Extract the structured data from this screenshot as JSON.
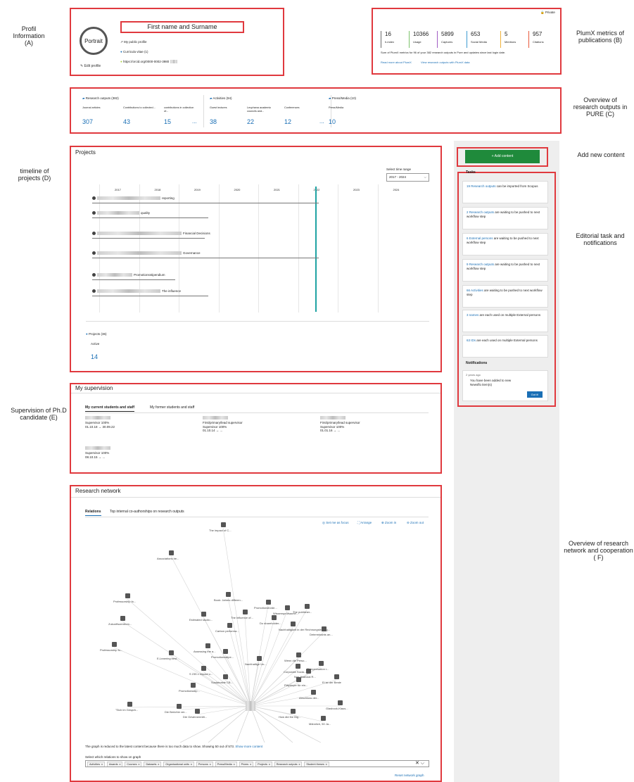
{
  "annotations": {
    "a": "Profil Information (A)",
    "b": "PlumX metrics of publications (B)",
    "c": "Overview of research outputs in PURE (C)",
    "add": "Add new content",
    "d": "timeline of projects (D)",
    "tasks": "Editorial task and notifications",
    "e": "Supervision of Ph.D candidate (E)",
    "f": "Overview of research network and cooperation ( F)"
  },
  "profile": {
    "portrait": "Portrait",
    "name": "First name and Surname",
    "links": [
      "My public profile",
      "Curricula vitae (1)",
      "https://orcid.org/0000-0002-3980"
    ],
    "edit": "Edit profile"
  },
  "plumx": {
    "private": "Private",
    "metrics": [
      {
        "value": "16",
        "label": "h-index"
      },
      {
        "value": "10366",
        "label": "Usage"
      },
      {
        "value": "5899",
        "label": "Captures"
      },
      {
        "value": "653",
        "label": "Social Media"
      },
      {
        "value": "5",
        "label": "Mentions"
      },
      {
        "value": "957",
        "label": "Citations"
      }
    ],
    "colors": [
      "#6b6b6b",
      "#7cc36b",
      "#a05cc4",
      "#3d9bd1",
      "#f0b23a",
      "#e85a3c"
    ],
    "note": "Sum of PlumX metrics for 96 of your 382 research outputs in Pure and updates since last login date.",
    "read_more": "Read more about PlumX",
    "view": "View research outputs with PlumX data"
  },
  "outputs": {
    "groups": [
      {
        "title": "Research outputs (382)",
        "items": [
          {
            "label": "Journal articles",
            "value": "307"
          },
          {
            "label": "Contributions to collected...",
            "value": "43"
          },
          {
            "label": "contributions in collection of...",
            "value": "15"
          }
        ]
      },
      {
        "title": "Activities (94)",
        "items": [
          {
            "label": "Guest lectures",
            "value": "38"
          },
          {
            "label": "Leuphana academic councils and...",
            "value": "22"
          },
          {
            "label": "Conferences",
            "value": "12"
          }
        ]
      },
      {
        "title": "Press/Media (10)",
        "items": [
          {
            "label": "Press/Media",
            "value": "10"
          }
        ]
      }
    ],
    "more": "..."
  },
  "add_content": "+ Add content",
  "projects": {
    "title": "Projects",
    "time_label": "Select time range",
    "time_value": "2017 - 2024",
    "years": [
      "2017",
      "2018",
      "2019",
      "2020",
      "2021",
      "2022",
      "2023",
      "2024"
    ],
    "rows": [
      "reporting",
      "quality",
      "Financial Decisions",
      "Governance",
      "Promotionsstipendium",
      "The influence"
    ],
    "summary_title": "Projects (36)",
    "summary_label": "Active",
    "summary_value": "14"
  },
  "tasks": {
    "title": "Tasks",
    "items": [
      {
        "link": "19 Research outputs",
        "text": " can be imported from Scopus"
      },
      {
        "link": "2 Research outputs",
        "text": " are waiting to be pushed to next workflow step"
      },
      {
        "link": "6 External persons",
        "text": " are waiting to be pushed to next workflow step"
      },
      {
        "link": "9 Research outputs",
        "text": " are waiting to be pushed to next workflow step"
      },
      {
        "link": "66 Activities",
        "text": " are waiting to be pushed to next workflow step"
      },
      {
        "link": "3 names",
        "text": " are each used on multiple External persons"
      },
      {
        "link": "63 IDs",
        "text": " are each used on multiple External persons"
      }
    ],
    "notif_title": "Notifications",
    "notif_time": "2 years ago",
    "notif_text": "You have been added to new Newsflo item(s)",
    "notif_btn": "Got it!"
  },
  "supervision": {
    "title": "My supervision",
    "tab1": "My current students and staff",
    "tab2": "My former students and staff",
    "students": [
      {
        "role": "Supervisor 100%",
        "dates": "01.10.18 → 30.09.22"
      },
      {
        "role": "First/primary/lead supervisor",
        "role2": "Supervisor 100%",
        "dates": "01.10.14 → ..."
      },
      {
        "role": "First/primary/lead supervisor",
        "role2": "Supervisor 100%",
        "dates": "01.01.16 → ..."
      },
      {
        "role": "Supervisor 100%",
        "dates": "08.10.15 → ..."
      }
    ]
  },
  "network": {
    "title": "Research network",
    "tab1": "Relations",
    "tab2": "Top internal co-authorships on research outputs",
    "tools": [
      "Set me as focus",
      "Arrange",
      "Zoom in",
      "Zoom out"
    ],
    "nodes": [
      "The impact of C...",
      "Associations be...",
      "Professorship fo...",
      "Zukunftszentrum...",
      "Professorship fo...",
      "Book: Jahres differen...",
      "Promotionsforde...",
      "Wissensprüfsache...",
      "The influence of...",
      "The publisher...",
      "Estimated studio...",
      "Carbon performa...",
      "Do shareholder...",
      "Nachhaltigkeit in der Rechnungslegung...",
      "Determinants an...",
      "Assessing the a...",
      "Promotionsstipe...",
      "Wenn die Perso...",
      "E-Learning best...",
      "Nachhaltige Un...",
      "Compensation r...",
      "S 235 c Impact o...",
      "Sustainable CB...",
      "Corporate Socia...",
      "Non-financial R...",
      "Promotionsstip...",
      "Pläydoyer für ein...",
      "Ei ist der Beste",
      "Abschluss der...",
      "Glasbook-Klaus...",
      "\"Sich im Gesprä...",
      "Die Berichte ver...",
      "Die Gewinnermitt...",
      "How did the Big...",
      "Männlich, 50 Ja..."
    ],
    "reduced": "The graph is reduced to the latest content because there is too much data to show. Showing 50 out of 573.",
    "show_more": "Show more content",
    "relations_label": "Select which relations to show on graph",
    "filters": [
      "Activities",
      "Awards",
      "Courses",
      "Datasets",
      "Organisational units",
      "Persons",
      "Press/Media",
      "Prizes",
      "Projects",
      "Research outputs",
      "Student theses"
    ],
    "reset": "Reset network graph"
  }
}
